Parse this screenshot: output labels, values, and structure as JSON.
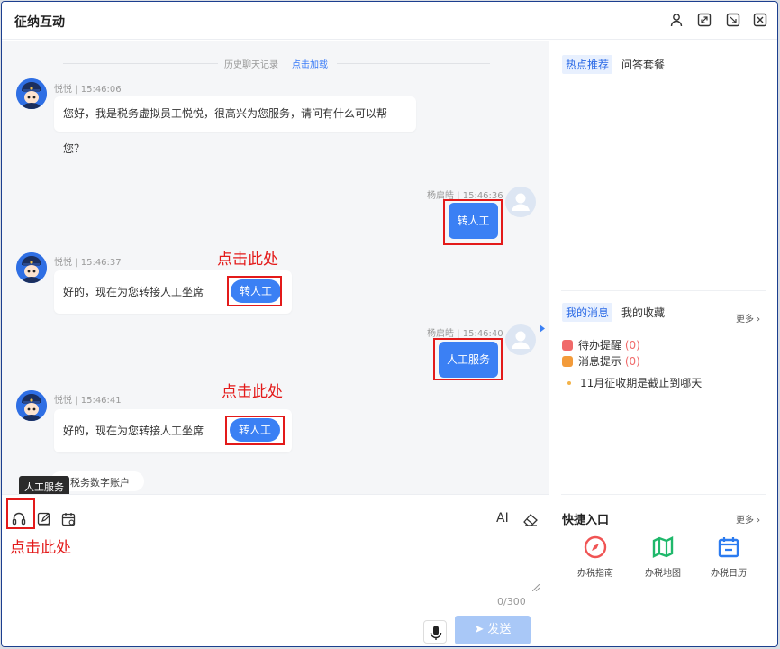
{
  "window": {
    "title": "征纳互动"
  },
  "history": {
    "text": "历史聊天记录",
    "link": "点击加载"
  },
  "messages": [
    {
      "meta": "悦悦 | 15:46:06",
      "text": "您好，我是税务虚拟员工悦悦，很高兴为您服务，请问有什么可以帮您？"
    },
    {
      "meta": "杨启皓 | 15:46:36",
      "button": "转人工"
    },
    {
      "meta": "悦悦 | 15:46:37",
      "text": "好的，现在为您转接人工坐席",
      "button": "转人工"
    },
    {
      "meta": "杨启皓 | 15:46:40",
      "button": "人工服务"
    },
    {
      "meta": "悦悦 | 15:46:41",
      "text": "好的，现在为您转接人工坐席",
      "button": "转人工"
    }
  ],
  "annotations": {
    "click_here": "点击此处"
  },
  "faq_chip": "税务数字账户",
  "tooltip": "人工服务",
  "composer": {
    "counter": "0/300",
    "send": "发送",
    "ai": "AI"
  },
  "right": {
    "tabs": [
      "热点推荐",
      "问答套餐"
    ],
    "msg_tabs": [
      "我的消息",
      "我的收藏"
    ],
    "more": "更多",
    "todo": {
      "label": "待办提醒",
      "count": "(0)"
    },
    "notice": {
      "label": "消息提示",
      "count": "(0)"
    },
    "bullet": "11月征收期是截止到哪天",
    "quick_title": "快捷入口",
    "quick_items": [
      "办税指南",
      "办税地图",
      "办税日历"
    ]
  },
  "colors": {
    "accent": "#3b80f4",
    "annotation": "#e31a1a"
  }
}
